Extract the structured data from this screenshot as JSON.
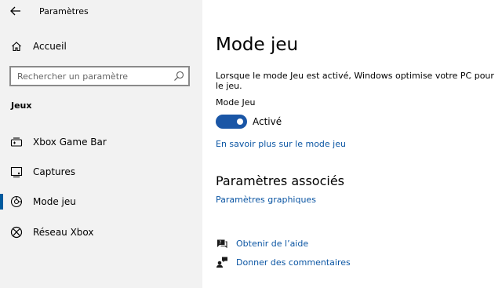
{
  "window": {
    "title": "Paramètres"
  },
  "sidebar": {
    "home_label": "Accueil",
    "search": {
      "placeholder": "Rechercher un paramètre"
    },
    "section_title": "Jeux",
    "items": [
      {
        "label": "Xbox Game Bar",
        "icon": "gamebar-icon",
        "selected": false
      },
      {
        "label": "Captures",
        "icon": "captures-icon",
        "selected": false
      },
      {
        "label": "Mode jeu",
        "icon": "game-mode-icon",
        "selected": true
      },
      {
        "label": "Réseau Xbox",
        "icon": "xbox-icon",
        "selected": false
      }
    ]
  },
  "main": {
    "title": "Mode jeu",
    "description": "Lorsque le mode Jeu est activé, Windows optimise votre PC pour le jeu.",
    "toggle": {
      "label": "Mode Jeu",
      "state_text": "Activé",
      "on": true
    },
    "learn_more": "En savoir plus sur le mode jeu",
    "related": {
      "title": "Paramètres associés",
      "graphics_link": "Paramètres graphiques"
    },
    "help": {
      "get_help": "Obtenir de l’aide",
      "feedback": "Donner des commentaires"
    }
  },
  "colors": {
    "accent": "#1a56a6",
    "link": "#0a55a3",
    "sidebar_bg": "#f2f2f2"
  }
}
